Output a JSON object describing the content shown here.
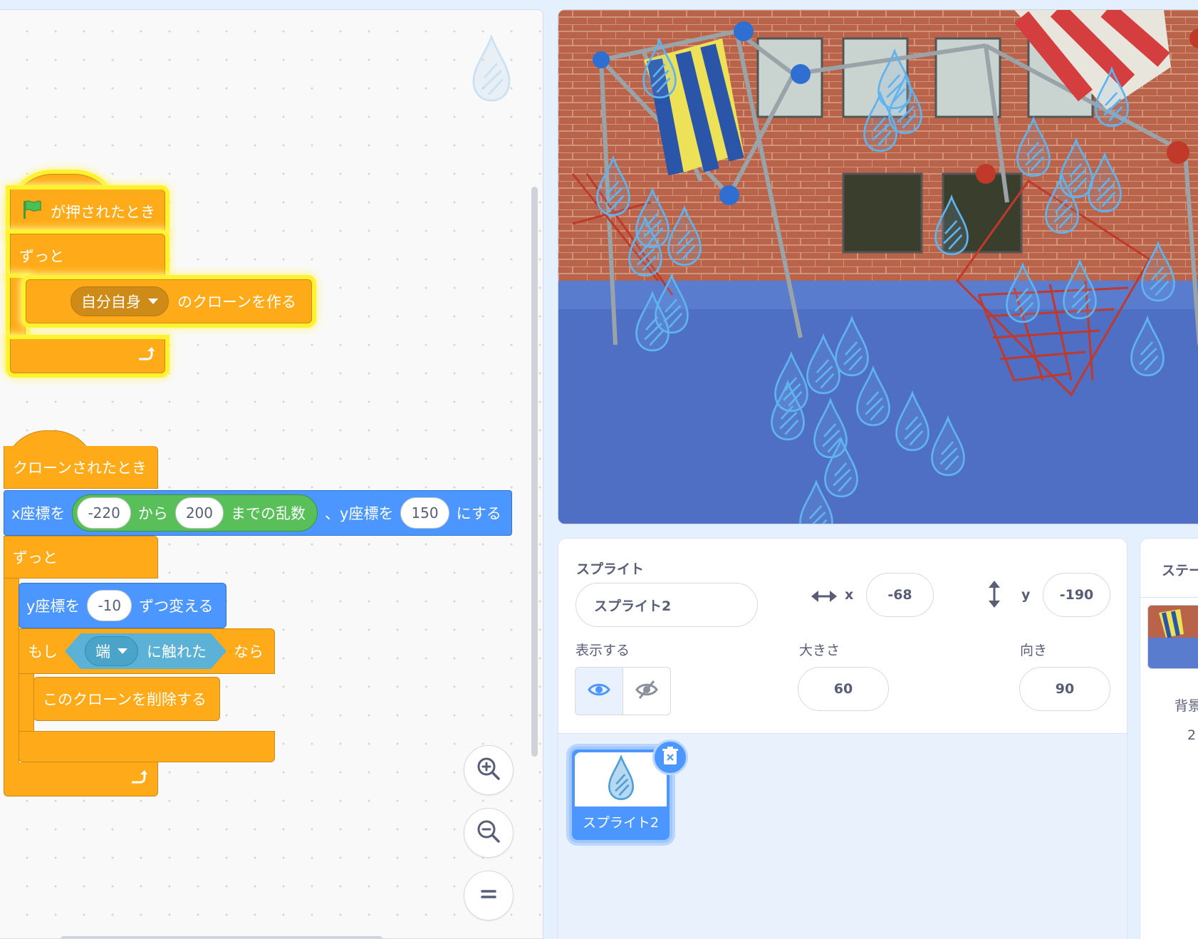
{
  "code": {
    "script1": {
      "hat": "が押されたとき",
      "forever": "ずっと",
      "clone_menu": "自分自身",
      "clone_label": "のクローンを作る"
    },
    "script2": {
      "hat": "クローンされたとき",
      "goto": {
        "x_label": "x座標を",
        "from_value": "-220",
        "from_label": "から",
        "to_value": "200",
        "random_label": "までの乱数",
        "sep_label": "、y座標を",
        "y_value": "150",
        "end_label": "にする"
      },
      "forever": "ずっと",
      "change_y": {
        "label": "y座標を",
        "value": "-10",
        "suffix": "ずつ変える"
      },
      "if": {
        "label": "もし",
        "touch_menu": "端",
        "touch_label": "に触れた",
        "then_label": "なら"
      },
      "delete_clone": "このクローンを削除する"
    }
  },
  "sprite_info": {
    "header": "スプライト",
    "name_value": "スプライト2",
    "x_label": "x",
    "x_value": "-68",
    "y_label": "y",
    "y_value": "-190",
    "show_label": "表示する",
    "size_label": "大きさ",
    "size_value": "60",
    "direction_label": "向き",
    "direction_value": "90"
  },
  "sprite_list": [
    {
      "name": "スプライト2"
    }
  ],
  "stage_panel": {
    "title": "ステー",
    "backdrop_label": "背景",
    "backdrop_count": "2"
  },
  "colors": {
    "events": "#ffab19",
    "motion": "#4c97ff",
    "operators": "#59c059",
    "sensing": "#5cb1d6",
    "selected": "#4c97ff",
    "glow": "#fff22e"
  },
  "icons": [
    "green-flag-icon",
    "loop-arrow-icon",
    "zoom-in-icon",
    "zoom-out-icon",
    "zoom-reset-icon",
    "eye-icon",
    "eye-slash-icon",
    "horizontal-arrows-icon",
    "vertical-arrows-icon",
    "trash-icon",
    "raindrop-icon"
  ]
}
